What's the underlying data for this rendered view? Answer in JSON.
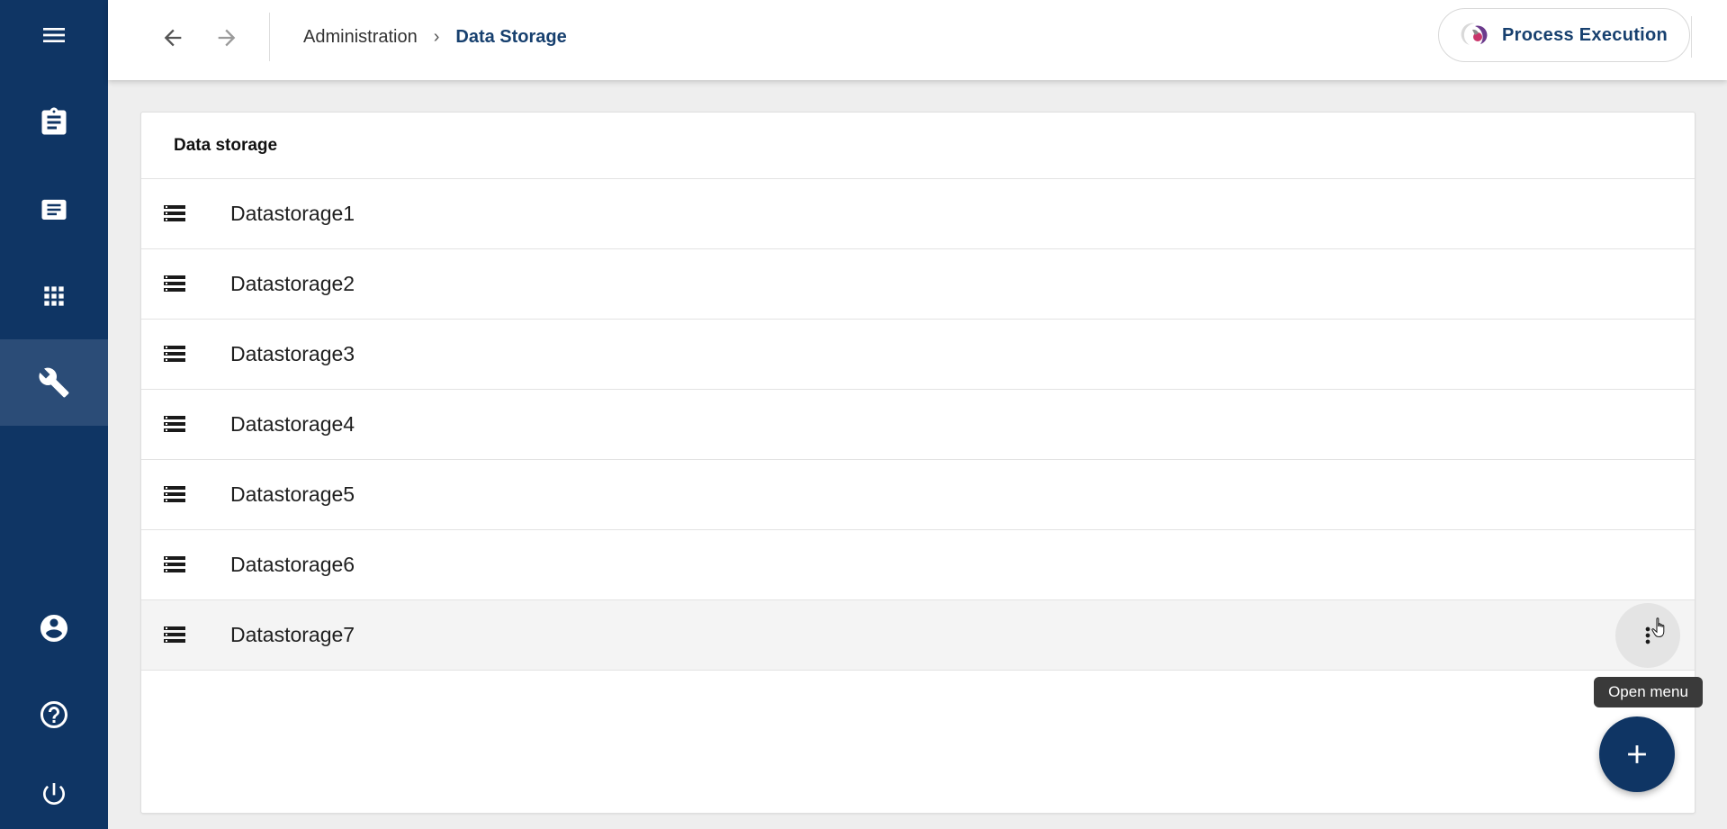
{
  "app": {
    "process_button_label": "Process Execution"
  },
  "breadcrumb": {
    "parent": "Administration",
    "separator": "›",
    "current": "Data Storage"
  },
  "card": {
    "title": "Data storage"
  },
  "rows": [
    {
      "label": "Datastorage1"
    },
    {
      "label": "Datastorage2"
    },
    {
      "label": "Datastorage3"
    },
    {
      "label": "Datastorage4"
    },
    {
      "label": "Datastorage5"
    },
    {
      "label": "Datastorage6"
    },
    {
      "label": "Datastorage7"
    }
  ],
  "tooltip": {
    "text": "Open menu"
  },
  "icons": {
    "sidebar": [
      "menu-icon",
      "clipboard-icon",
      "document-icon",
      "apps-grid-icon",
      "wrench-icon",
      "account-icon",
      "help-icon",
      "power-icon"
    ],
    "row": "storage-icon",
    "fab": "plus-icon"
  },
  "colors": {
    "primary": "#0f3564",
    "sidebar_active": "#2b4c77",
    "breadcrumb_current": "#17406f"
  }
}
